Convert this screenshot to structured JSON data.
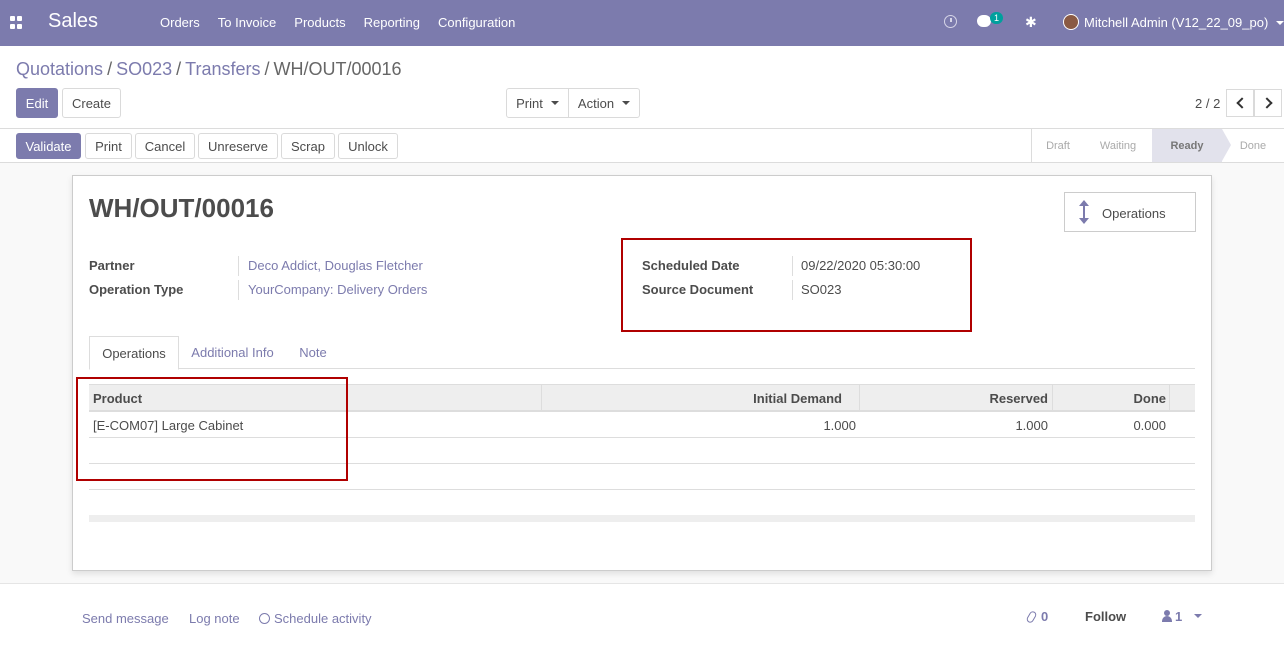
{
  "navbar": {
    "brand": "Sales",
    "menu": [
      "Orders",
      "To Invoice",
      "Products",
      "Reporting",
      "Configuration"
    ],
    "chat_badge": "1",
    "user": "Mitchell Admin (V12_22_09_po)"
  },
  "breadcrumb": {
    "items": [
      "Quotations",
      "SO023",
      "Transfers"
    ],
    "current": "WH/OUT/00016"
  },
  "toolbar": {
    "edit": "Edit",
    "create": "Create",
    "print": "Print",
    "action": "Action",
    "pager": "2 / 2"
  },
  "statusbar": {
    "buttons": [
      "Validate",
      "Print",
      "Cancel",
      "Unreserve",
      "Scrap",
      "Unlock"
    ],
    "stages": [
      "Draft",
      "Waiting",
      "Ready",
      "Done"
    ],
    "active_stage": "Ready"
  },
  "form": {
    "title": "WH/OUT/00016",
    "smart_button": "Operations",
    "partner_label": "Partner",
    "partner_value": "Deco Addict, Douglas Fletcher",
    "operation_type_label": "Operation Type",
    "operation_type_value": "YourCompany: Delivery Orders",
    "scheduled_date_label": "Scheduled Date",
    "scheduled_date_value": "09/22/2020 05:30:00",
    "source_document_label": "Source Document",
    "source_document_value": "SO023",
    "tabs": [
      "Operations",
      "Additional Info",
      "Note"
    ],
    "table": {
      "headers": [
        "Product",
        "Initial Demand",
        "Reserved",
        "Done"
      ],
      "rows": [
        {
          "product": "[E-COM07] Large Cabinet",
          "initial_demand": "1.000",
          "reserved": "1.000",
          "done": "0.000"
        }
      ]
    }
  },
  "chatter": {
    "send_message": "Send message",
    "log_note": "Log note",
    "schedule_activity": "Schedule activity",
    "attachments": "0",
    "follow": "Follow",
    "followers": "1"
  }
}
